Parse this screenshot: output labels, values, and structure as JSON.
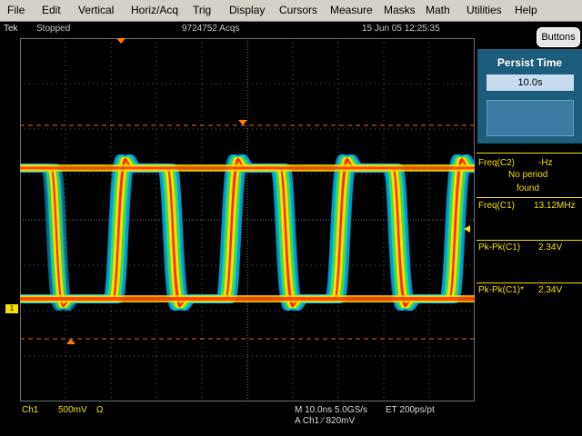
{
  "menu": [
    "File",
    "Edit",
    "Vertical",
    "Horiz/Acq",
    "Trig",
    "Display",
    "Cursors",
    "Measure",
    "Masks",
    "Math",
    "Utilities",
    "Help"
  ],
  "status": {
    "brand": "Tek",
    "run_state": "Stopped",
    "acquisitions": "9724752 Acqs",
    "datetime": "15 Jun 05 12:25:35"
  },
  "buttons_label": "Buttons",
  "persist": {
    "title": "Persist Time",
    "value": "10.0s"
  },
  "measurements": {
    "freq_c2_label": "Freq(C2)",
    "freq_c2_value": "-Hz",
    "freq_c2_note1": "No period",
    "freq_c2_note2": "found",
    "freq_c1_label": "Freq(C1)",
    "freq_c1_value": "13.12MHz",
    "pkpk_c1_label": "Pk-Pk(C1)",
    "pkpk_c1_value": "2.34V",
    "pkpk_c1s_label": "Pk-Pk(C1)*",
    "pkpk_c1s_value": "2.34V"
  },
  "channel": {
    "name": "Ch1",
    "scale": "500mV",
    "coupling": "Ω",
    "ground_marker": "1"
  },
  "timebase": {
    "horizontal": "M 10.0ns 5.0GS/s",
    "et": "ET 200ps/pt",
    "trigger": "A  Ch1  ∕  820mV"
  },
  "colors": {
    "trace_hot": "#ff2800",
    "trace_warm": "#ffe000",
    "trace_mid": "#40e040",
    "trace_cool": "#00c0ff",
    "measure_text": "#f5e000",
    "panel": "#1c5c7c"
  }
}
